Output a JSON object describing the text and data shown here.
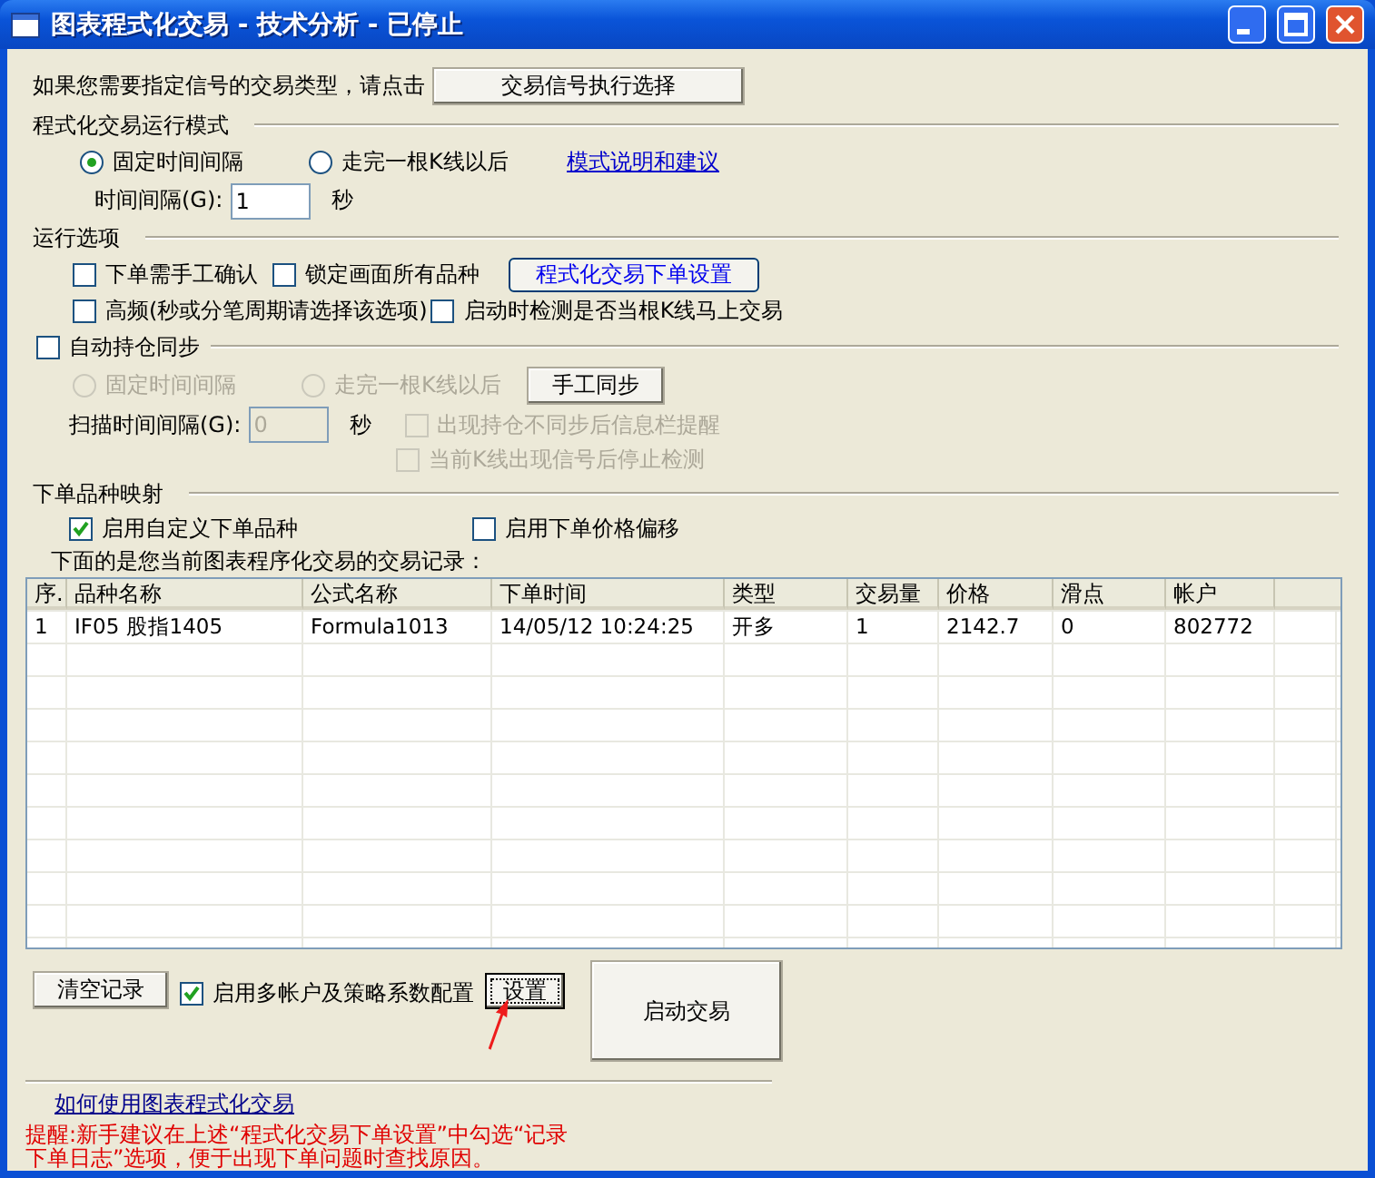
{
  "window": {
    "title": "图表程式化交易 - 技术分析 - 已停止"
  },
  "signal_prompt": {
    "text": "如果您需要指定信号的交易类型，请点击",
    "button": "交易信号执行选择"
  },
  "run_mode": {
    "heading": "程式化交易运行模式",
    "radios": [
      {
        "label": "固定时间间隔",
        "selected": true
      },
      {
        "label": "走完一根K线以后",
        "selected": false
      }
    ],
    "link": "模式说明和建议",
    "interval": {
      "label": "时间间隔(G):",
      "value": "1",
      "unit": "秒"
    }
  },
  "run_options": {
    "heading": "运行选项",
    "checkboxes": [
      {
        "label": "下单需手工确认",
        "checked": false
      },
      {
        "label": "锁定画面所有品种",
        "checked": false
      },
      {
        "label": "高频(秒或分笔周期请选择该选项)",
        "checked": false
      },
      {
        "label": "启动时检测是否当根K线马上交易",
        "checked": false
      }
    ],
    "button": "程式化交易下单设置"
  },
  "sync": {
    "label": "自动持仓同步",
    "checked": false,
    "radios": [
      {
        "label": "固定时间间隔",
        "selected": false,
        "disabled": true
      },
      {
        "label": "走完一根K线以后",
        "selected": false,
        "disabled": true
      }
    ],
    "button": "手工同步",
    "scan": {
      "label": "扫描时间间隔(G):",
      "value": "0",
      "unit": "秒",
      "disabled": true
    },
    "checkboxes": [
      {
        "label": "出现持仓不同步后信息栏提醒",
        "checked": false,
        "disabled": true
      },
      {
        "label": "当前K线出现信号后停止检测",
        "checked": false,
        "disabled": true
      }
    ]
  },
  "mapping": {
    "heading": "下单品种映射",
    "checkboxes": [
      {
        "label": "启用自定义下单品种",
        "checked": true
      },
      {
        "label": "启用下单价格偏移",
        "checked": false
      }
    ]
  },
  "records": {
    "caption": "下面的是您当前图表程序化交易的交易记录：",
    "columns": [
      "序.",
      "品种名称",
      "公式名称",
      "下单时间",
      "类型",
      "交易量",
      "价格",
      "滑点",
      "帐户"
    ],
    "rows": [
      [
        "1",
        "IF05 股指1405",
        "Formula1013",
        "14/05/12 10:24:25",
        "开多",
        "1",
        "2142.7",
        "0",
        "802772"
      ]
    ]
  },
  "bottom": {
    "clear_button": "清空记录",
    "multi_account": {
      "label": "启用多帐户及策略系数配置",
      "checked": true
    },
    "settings_button": "设置",
    "start_button": "启动交易"
  },
  "help_link": "如何使用图表程式化交易",
  "warning": [
    "提醒:新手建议在上述“程式化交易下单设置”中勾选“记录",
    "下单日志”选项，便于出现下单问题时查找原因。"
  ]
}
